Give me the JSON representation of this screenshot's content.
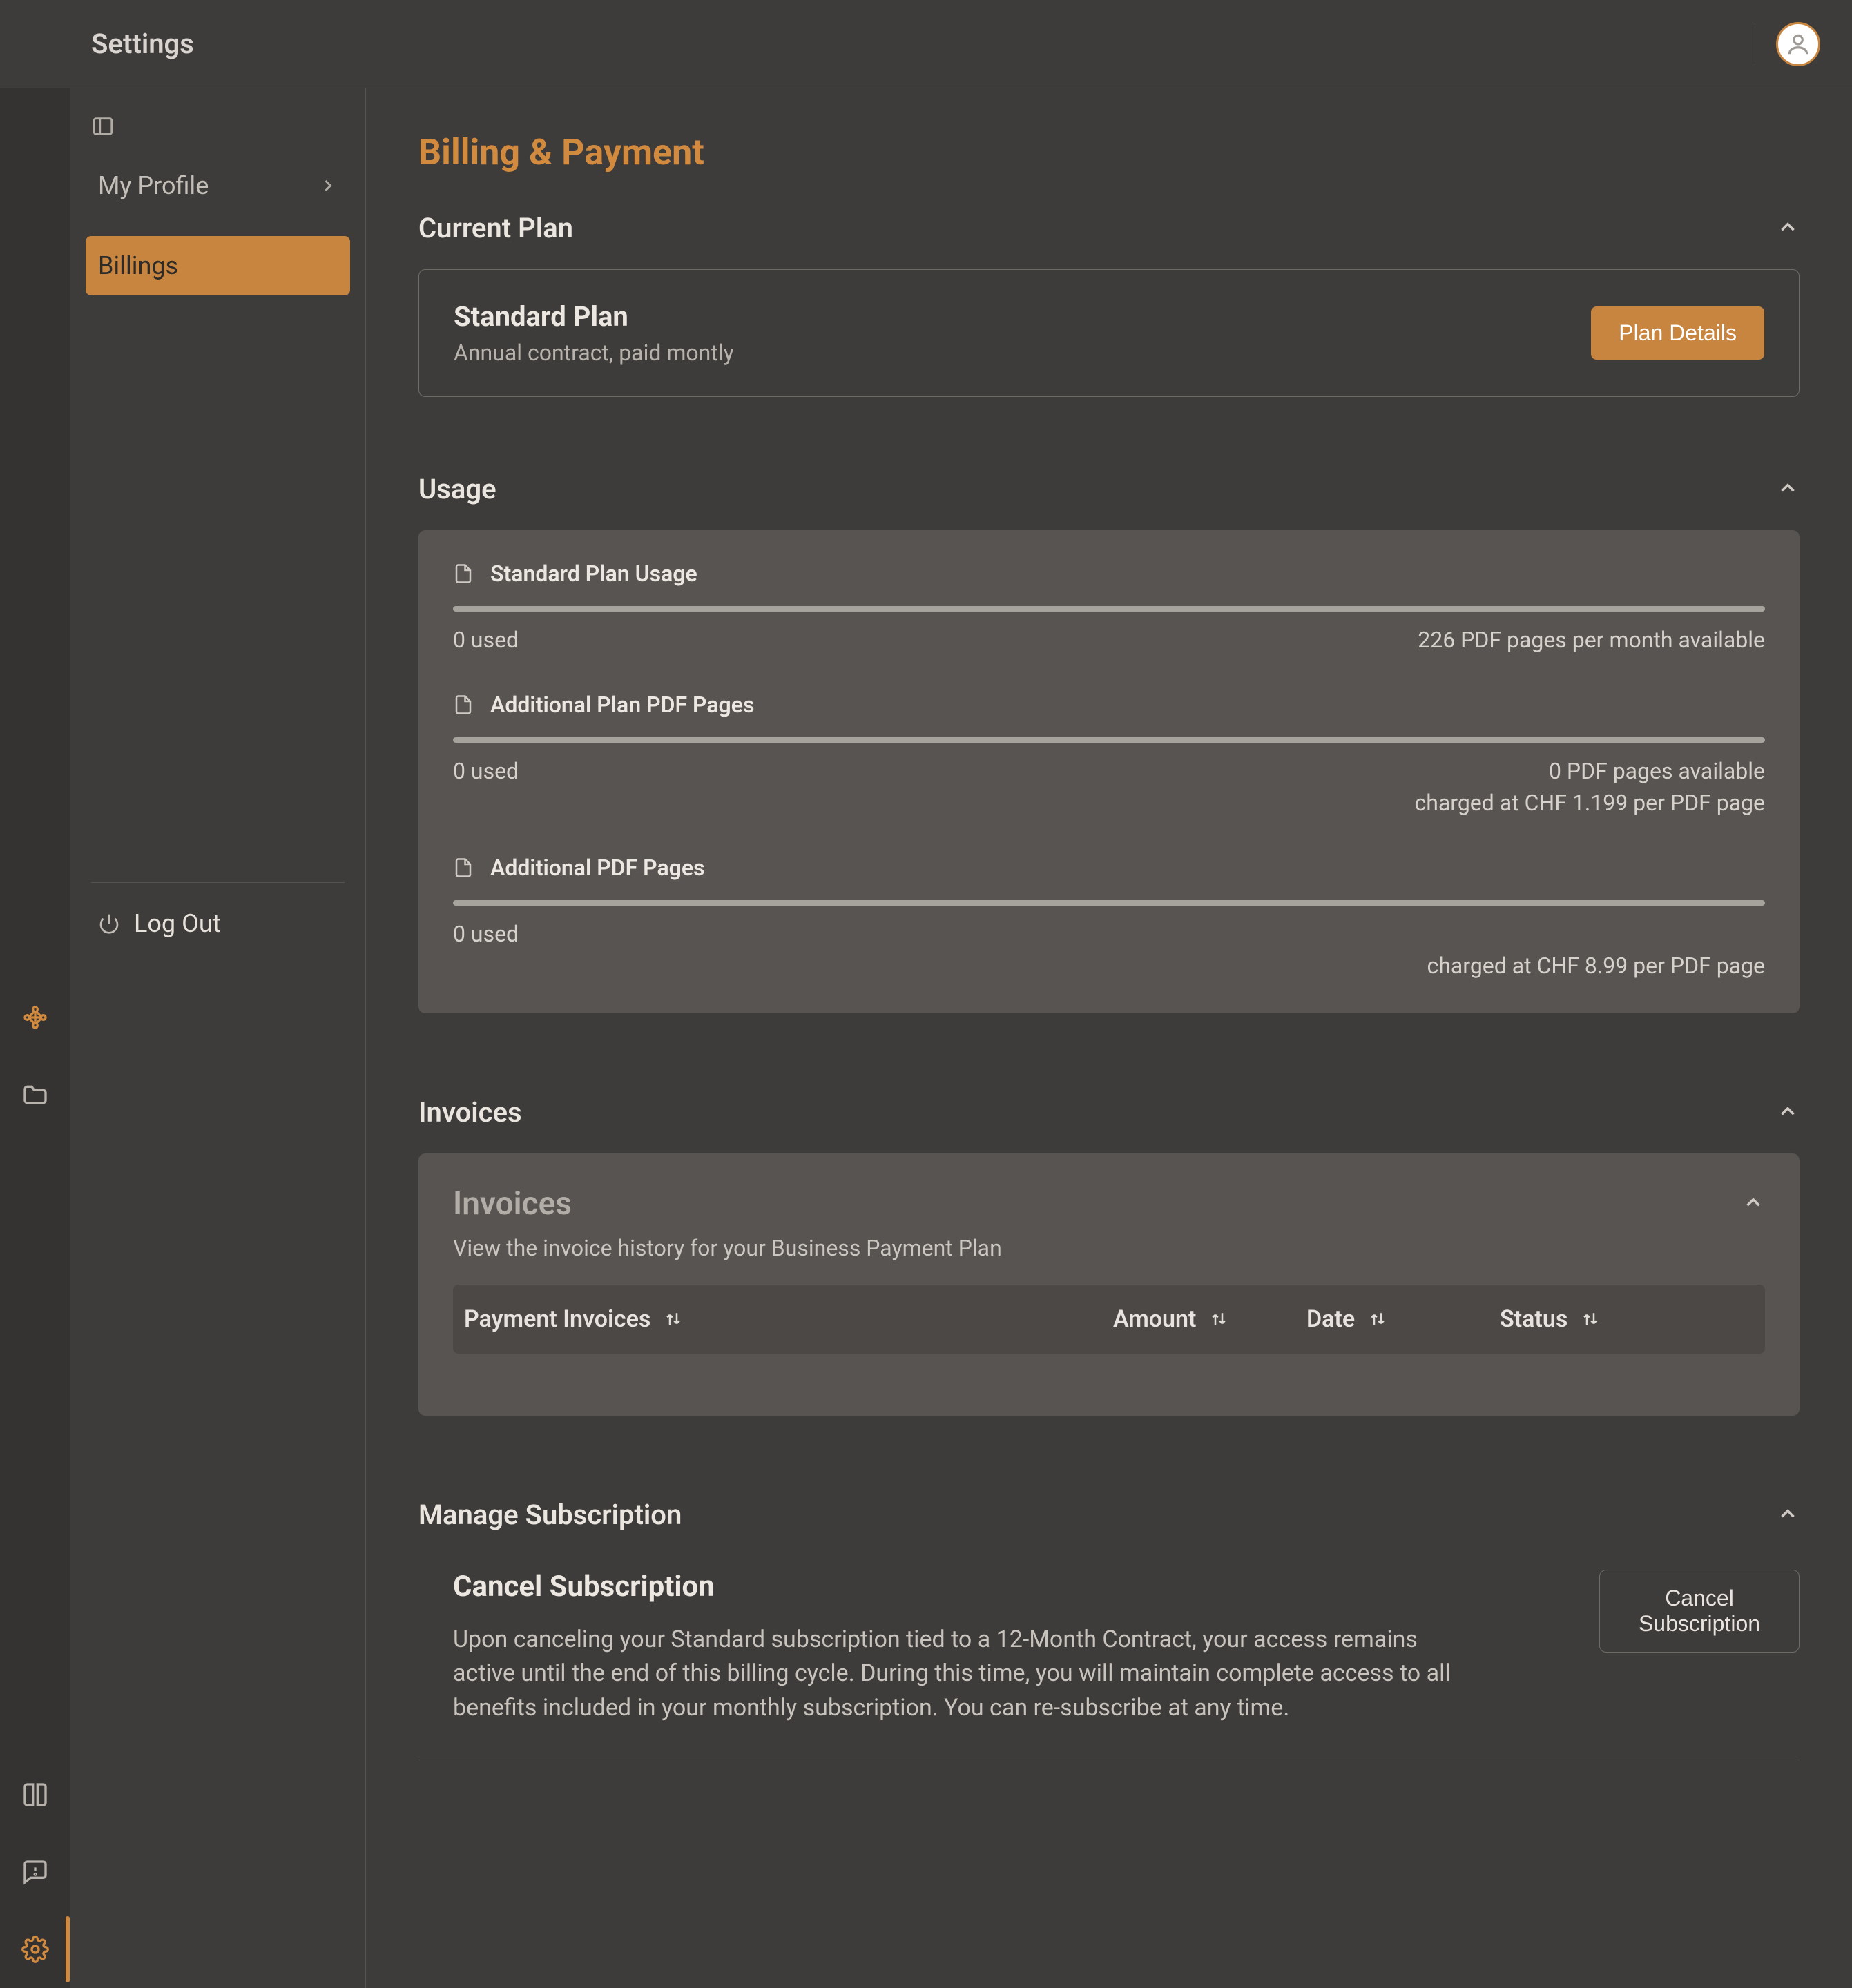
{
  "header": {
    "title": "Settings"
  },
  "sidebar": {
    "items": [
      {
        "label": "My Profile"
      },
      {
        "label": "Billings"
      }
    ],
    "logout_label": "Log Out"
  },
  "page": {
    "title": "Billing & Payment"
  },
  "current_plan": {
    "section_title": "Current Plan",
    "name": "Standard Plan",
    "subtitle": "Annual contract, paid montly",
    "button": "Plan Details"
  },
  "usage": {
    "section_title": "Usage",
    "blocks": [
      {
        "title": "Standard Plan Usage",
        "left": "0 used",
        "right": "226 PDF pages per month available",
        "extra": ""
      },
      {
        "title": "Additional Plan PDF Pages",
        "left": "0 used",
        "right": "0 PDF pages available",
        "extra": "charged at CHF 1.199 per PDF page"
      },
      {
        "title": "Additional PDF Pages",
        "left": "0 used",
        "right": "",
        "extra": "charged at CHF 8.99 per PDF page"
      }
    ]
  },
  "invoices": {
    "section_title": "Invoices",
    "panel_title": "Invoices",
    "panel_sub": "View the invoice history for your Business Payment Plan",
    "columns": {
      "payment": "Payment Invoices",
      "amount": "Amount",
      "date": "Date",
      "status": "Status"
    }
  },
  "manage": {
    "section_title": "Manage Subscription",
    "cancel_title": "Cancel Subscription",
    "cancel_body": "Upon canceling your Standard subscription tied to a 12-Month Contract, your access remains active until the end of this billing cycle. During this time, you will maintain complete access to all benefits included in your monthly subscription. You can re-subscribe at any time.",
    "cancel_button": "Cancel Subscription"
  }
}
